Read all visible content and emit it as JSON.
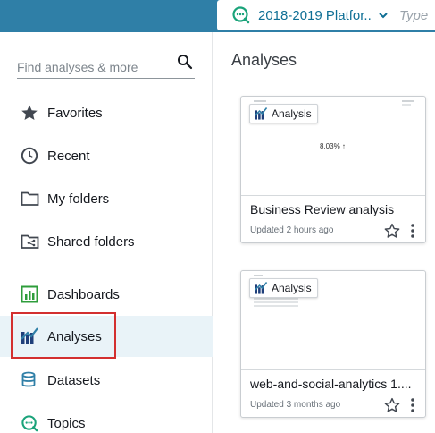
{
  "topbar": {
    "topic_name": "2018-2019 Platfor...",
    "type_placeholder": "Type"
  },
  "sidebar": {
    "search_placeholder": "Find analyses & more",
    "items": [
      {
        "label": "Favorites",
        "icon": "star-icon"
      },
      {
        "label": "Recent",
        "icon": "clock-icon"
      },
      {
        "label": "My folders",
        "icon": "folder-icon"
      },
      {
        "label": "Shared folders",
        "icon": "shared-folder-icon"
      },
      {
        "label": "Dashboards",
        "icon": "dashboard-icon"
      },
      {
        "label": "Analyses",
        "icon": "analyses-icon",
        "active": true
      },
      {
        "label": "Datasets",
        "icon": "database-icon"
      },
      {
        "label": "Topics",
        "icon": "topics-icon"
      }
    ]
  },
  "main": {
    "title": "Analyses",
    "cards": [
      {
        "badge": "Analysis",
        "thumb_kpi": "8.03% ↑",
        "name": "Business Review analysis",
        "updated": "Updated 2 hours ago"
      },
      {
        "badge": "Analysis",
        "name": "web-and-social-analytics 1....",
        "updated": "Updated 3 months ago"
      }
    ]
  },
  "colors": {
    "topbar": "#2f7fa7",
    "accent": "#0f6f95",
    "active_bg": "#e9f3f8",
    "highlight": "#d32f2f",
    "dashboard_green": "#2e9d3b",
    "analyses_navy": "#1f3f7a"
  }
}
